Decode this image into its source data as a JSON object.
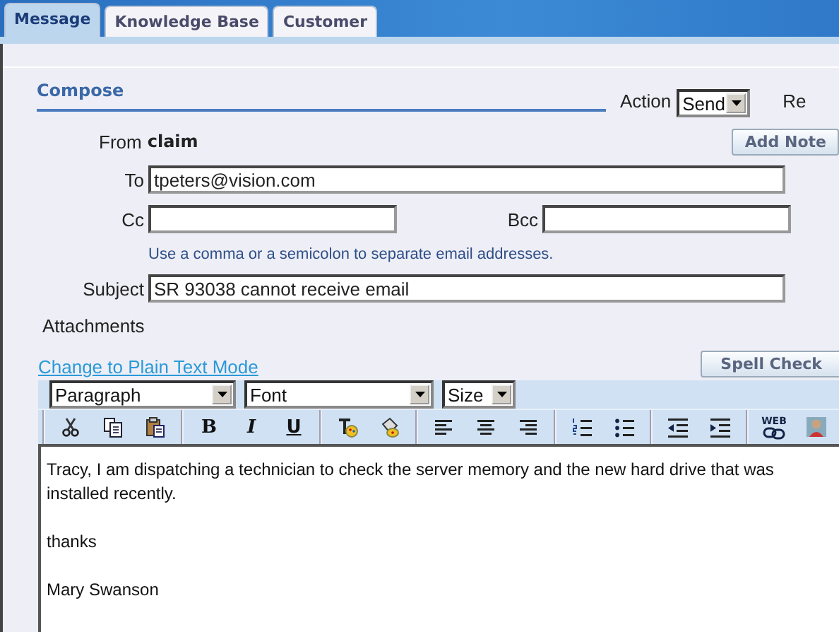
{
  "tabs": [
    {
      "label": "Message",
      "selected": true
    },
    {
      "label": "Knowledge Base",
      "selected": false
    },
    {
      "label": "Customer",
      "selected": false
    }
  ],
  "compose": {
    "title": "Compose",
    "action_label": "Action",
    "action_value": "Send",
    "cut_label": "Re"
  },
  "from": {
    "label": "From",
    "value": "claim"
  },
  "add_note_button": "Add Note",
  "to": {
    "label": "To",
    "value": "tpeters@vision.com"
  },
  "cc": {
    "label": "Cc"
  },
  "bcc": {
    "label": "Bcc"
  },
  "hint": "Use a comma or a semicolon to separate email addresses.",
  "subject": {
    "label": "Subject",
    "value": "SR 93038 cannot receive email"
  },
  "attachments_label": "Attachments",
  "plain_text_link": "Change to Plain Text Mode",
  "spell_check_button": "Spell Check",
  "format_selects": [
    {
      "value": "Paragraph"
    },
    {
      "value": "Font"
    },
    {
      "value": "Size"
    }
  ],
  "toolbar": [
    [
      {
        "kind": "cut"
      },
      {
        "kind": "copy"
      },
      {
        "kind": "paste"
      }
    ],
    [
      {
        "kind": "bold",
        "label": "B"
      },
      {
        "kind": "italic",
        "label": "I"
      },
      {
        "kind": "underline",
        "label": "U"
      }
    ],
    [
      {
        "kind": "clear-format"
      },
      {
        "kind": "fill"
      }
    ],
    [
      {
        "kind": "align-left"
      },
      {
        "kind": "align-center"
      },
      {
        "kind": "align-right"
      }
    ],
    [
      {
        "kind": "numbered-list"
      },
      {
        "kind": "bullet-list"
      }
    ],
    [
      {
        "kind": "outdent"
      },
      {
        "kind": "indent"
      }
    ],
    [
      {
        "kind": "link",
        "label": "WEB"
      },
      {
        "kind": "image"
      }
    ]
  ],
  "editor": {
    "paragraphs": [
      "Tracy, I am dispatching a technician to check the server memory and the new hard drive that was installed recently.",
      "thanks",
      "Mary Swanson"
    ]
  }
}
